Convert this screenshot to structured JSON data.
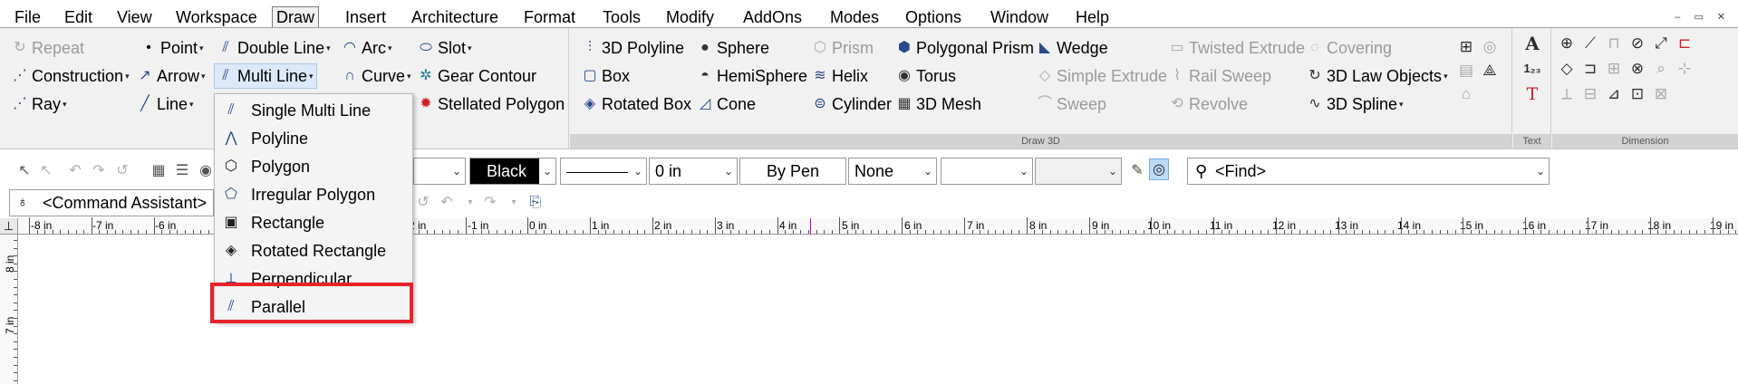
{
  "menubar": {
    "items": [
      "File",
      "Edit",
      "View",
      "Workspace",
      "Draw",
      "Insert",
      "Architecture",
      "Format",
      "Tools",
      "Modify",
      "AddOns",
      "Modes",
      "Options",
      "Window",
      "Help"
    ],
    "active": "Draw"
  },
  "ribbon": {
    "col1": [
      {
        "label": "Repeat",
        "icon": "repeat-icon",
        "disabled": true
      },
      {
        "label": "Construction",
        "icon": "construction-line-icon",
        "dropdown": true
      },
      {
        "label": "Ray",
        "icon": "ray-icon",
        "dropdown": true
      }
    ],
    "col2": [
      {
        "label": "Point",
        "icon": "point-icon",
        "dropdown": true
      },
      {
        "label": "Arrow",
        "icon": "arrow-icon",
        "dropdown": true
      },
      {
        "label": "Line",
        "icon": "line-icon",
        "dropdown": true
      }
    ],
    "col3": [
      {
        "label": "Double Line",
        "icon": "double-line-icon",
        "dropdown": true
      },
      {
        "label": "Multi Line",
        "icon": "multi-line-icon",
        "dropdown": true,
        "pressed": true
      }
    ],
    "col4": [
      {
        "label": "Arc",
        "icon": "arc-icon",
        "dropdown": true
      },
      {
        "label": "Curve",
        "icon": "curve-icon",
        "dropdown": true
      }
    ],
    "col5": [
      {
        "label": "Slot",
        "icon": "slot-icon",
        "dropdown": true
      },
      {
        "label": "Gear Contour",
        "icon": "gear-contour-icon"
      },
      {
        "label": "Stellated Polygon",
        "icon": "stellated-polygon-icon"
      }
    ],
    "draw3d": {
      "footer": "Draw 3D",
      "col1": [
        {
          "label": "3D Polyline",
          "icon": "3d-polyline-icon"
        },
        {
          "label": "Box",
          "icon": "box-icon"
        },
        {
          "label": "Rotated Box",
          "icon": "rotated-box-icon"
        }
      ],
      "col2": [
        {
          "label": "Sphere",
          "icon": "sphere-icon"
        },
        {
          "label": "HemiSphere",
          "icon": "hemisphere-icon"
        },
        {
          "label": "Cone",
          "icon": "cone-icon"
        }
      ],
      "col3": [
        {
          "label": "Prism",
          "icon": "prism-icon",
          "disabled": true
        },
        {
          "label": "Helix",
          "icon": "helix-icon"
        },
        {
          "label": "Cylinder",
          "icon": "cylinder-icon"
        }
      ],
      "col4": [
        {
          "label": "Polygonal Prism",
          "icon": "polygonal-prism-icon"
        },
        {
          "label": "Torus",
          "icon": "torus-icon"
        },
        {
          "label": "3D Mesh",
          "icon": "3d-mesh-icon"
        }
      ],
      "col5": [
        {
          "label": "Wedge",
          "icon": "wedge-icon"
        },
        {
          "label": "Simple Extrude",
          "icon": "simple-extrude-icon",
          "disabled": true
        },
        {
          "label": "Sweep",
          "icon": "sweep-icon",
          "disabled": true
        }
      ],
      "col6": [
        {
          "label": "Twisted Extrude",
          "icon": "twisted-extrude-icon",
          "disabled": true
        },
        {
          "label": "Rail Sweep",
          "icon": "rail-sweep-icon",
          "disabled": true
        },
        {
          "label": "Revolve",
          "icon": "revolve-icon",
          "disabled": true
        }
      ],
      "col7": [
        {
          "label": "Covering",
          "icon": "covering-icon",
          "disabled": true
        },
        {
          "label": "3D Law Objects",
          "icon": "3d-law-objects-icon",
          "dropdown": true
        },
        {
          "label": "3D Spline",
          "icon": "3d-spline-icon",
          "dropdown": true
        }
      ]
    },
    "text_footer": "Text",
    "dimension_footer": "Dimension"
  },
  "dropdown": {
    "items": [
      {
        "label": "Single Multi Line",
        "icon": "single-multi-line-icon"
      },
      {
        "label": "Polyline",
        "icon": "polyline-icon"
      },
      {
        "label": "Polygon",
        "icon": "polygon-icon"
      },
      {
        "label": "Irregular Polygon",
        "icon": "irregular-polygon-icon"
      },
      {
        "label": "Rectangle",
        "icon": "rectangle-icon"
      },
      {
        "label": "Rotated Rectangle",
        "icon": "rotated-rectangle-icon"
      },
      {
        "label": "Perpendicular",
        "icon": "perpendicular-icon"
      },
      {
        "label": "Parallel",
        "icon": "parallel-icon"
      }
    ],
    "highlighted": "Parallel"
  },
  "toolbar": {
    "color_value": "Black",
    "thickness_value": "0 in",
    "pen_value": "By Pen",
    "fill_value": "None",
    "find_placeholder": "<Find>",
    "command_assistant": "<Command Assistant>"
  },
  "ruler": {
    "h_labels": [
      "-8 in",
      "-7 in",
      "-6 in",
      "-2 in",
      "-1 in",
      "0 in",
      "1 in",
      "2 in",
      "3 in",
      "4 in",
      "5 in",
      "6 in",
      "7 in",
      "8 in",
      "9 in",
      "10 in",
      "11 in",
      "12 in",
      "13 in",
      "14 in",
      "15 in",
      "16 in",
      "17 in",
      "18 in",
      "19 in"
    ],
    "v_labels": [
      "8 in",
      "7 in"
    ]
  }
}
